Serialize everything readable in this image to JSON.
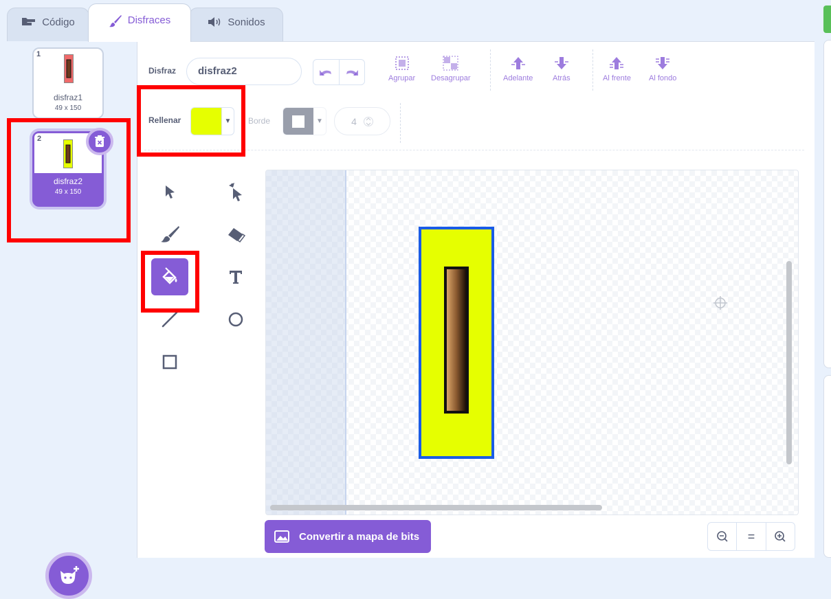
{
  "tabs": {
    "code": "Código",
    "costumes": "Disfraces",
    "sounds": "Sonidos"
  },
  "costumes": [
    {
      "number": "1",
      "name": "disfraz1",
      "size": "49 x 150"
    },
    {
      "number": "2",
      "name": "disfraz2",
      "size": "49 x 150"
    }
  ],
  "editor": {
    "costume_label": "Disfraz",
    "costume_name": "disfraz2",
    "fill_label": "Rellenar",
    "border_label": "Borde",
    "border_width": "4",
    "fill_color": "#e6ff00",
    "accent": "#855cd6",
    "toolbar": {
      "group": "Agrupar",
      "ungroup": "Desagrupar",
      "forward": "Adelante",
      "backward": "Atrás",
      "front": "Al frente",
      "back": "Al fondo"
    },
    "convert_button": "Convertir a mapa de bits",
    "zoom": {
      "out": "−",
      "reset": "=",
      "in": "+"
    }
  }
}
